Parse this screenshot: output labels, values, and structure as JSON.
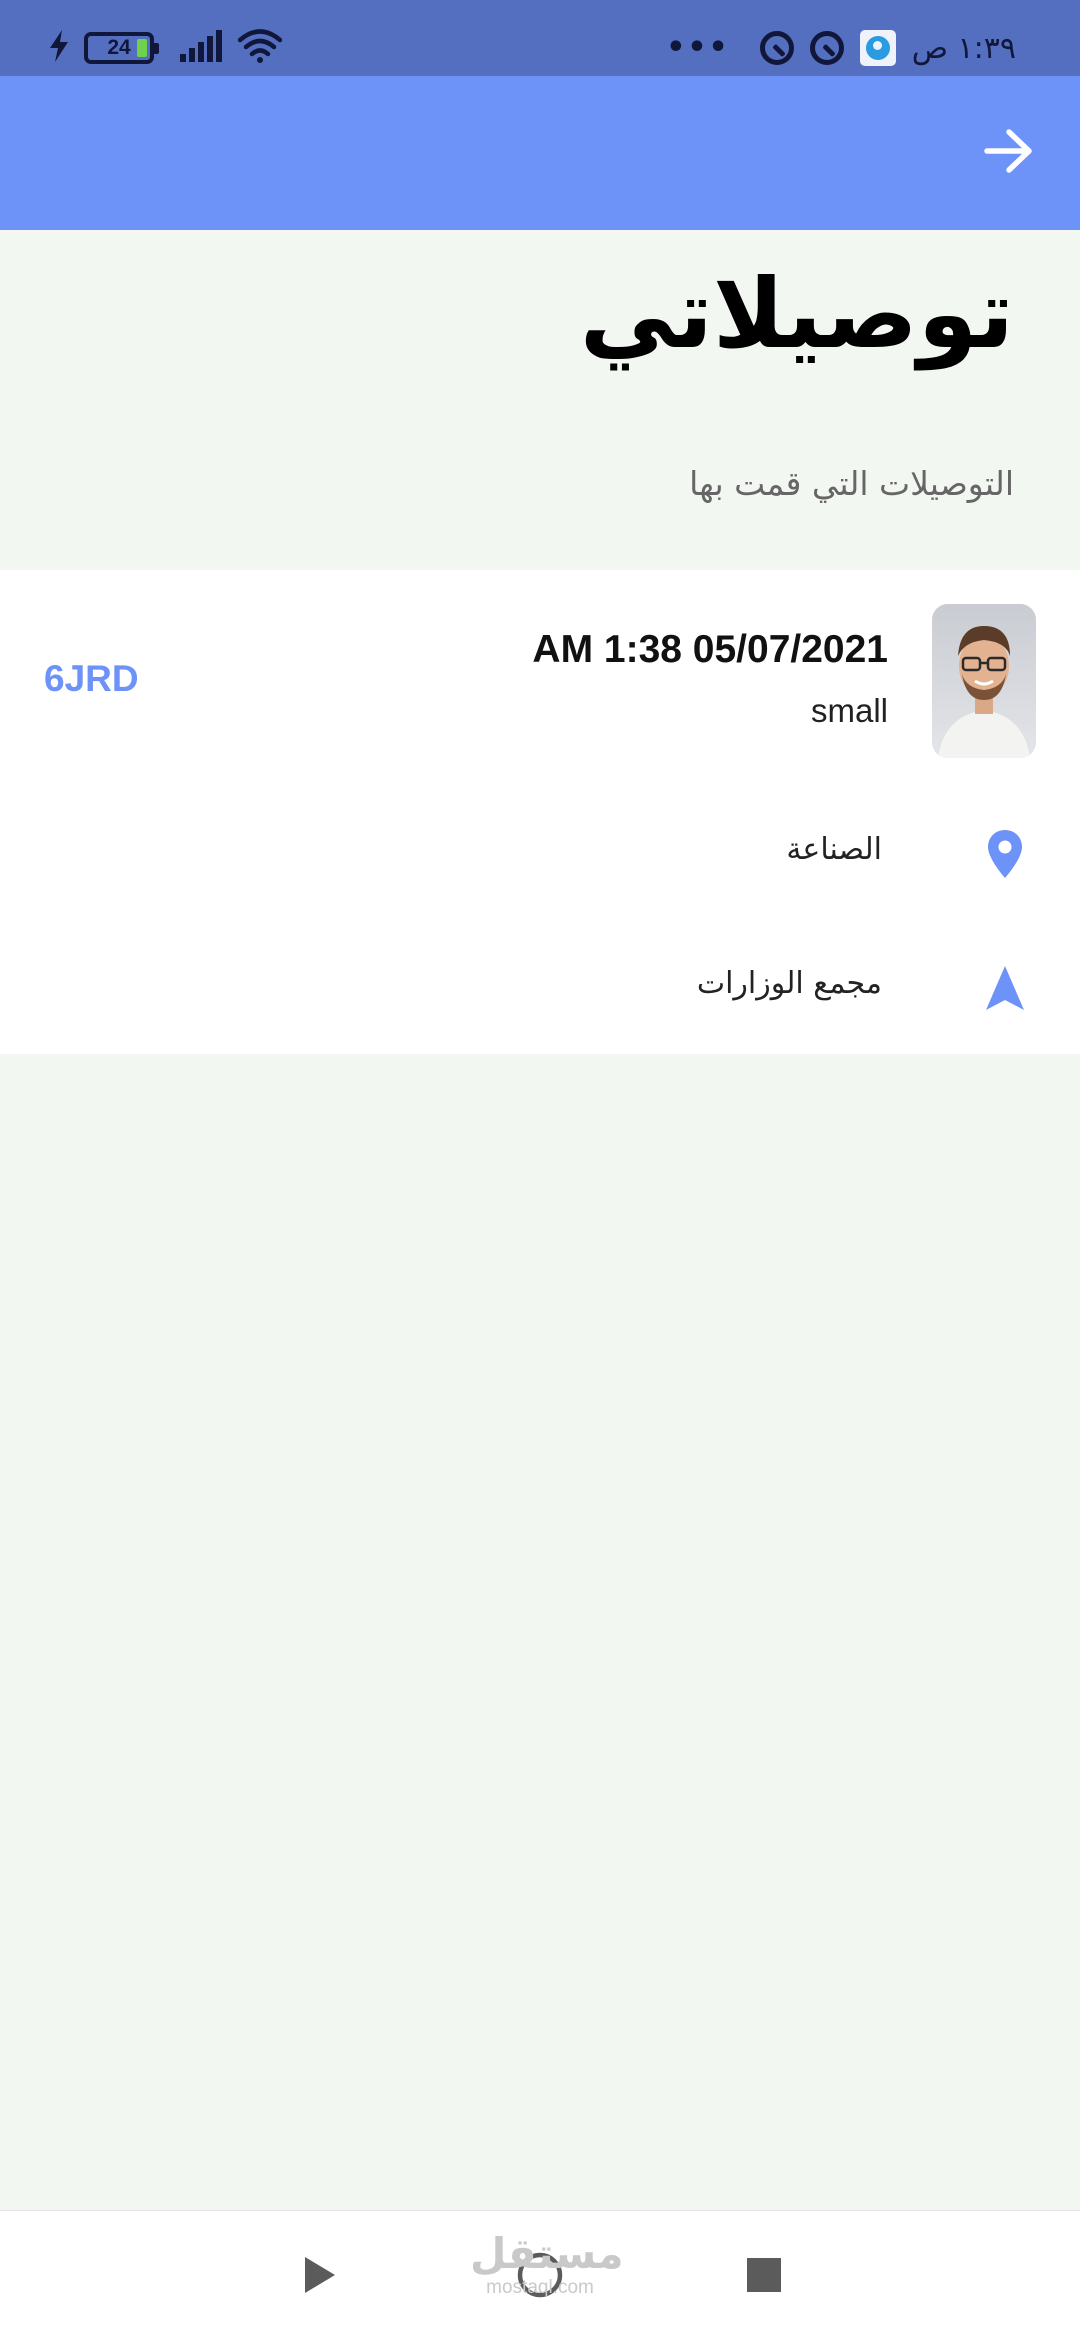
{
  "status_bar": {
    "battery_level": "24",
    "time": "١:٣٩ ص"
  },
  "header": {
    "title": "توصيلاتي",
    "subtitle": "التوصيلات التي قمت بها"
  },
  "delivery": {
    "datetime": "AM 1:38 05/07/2021",
    "size": "small",
    "code": "6JRD",
    "pickup": "الصناعة",
    "dropoff": "مجمع الوزارات"
  },
  "watermark": {
    "arabic": "مستقل",
    "latin": "mostaql.com"
  },
  "colors": {
    "accent": "#6d93f8",
    "status_bar": "#546fc0",
    "background": "#f3f7f1"
  }
}
